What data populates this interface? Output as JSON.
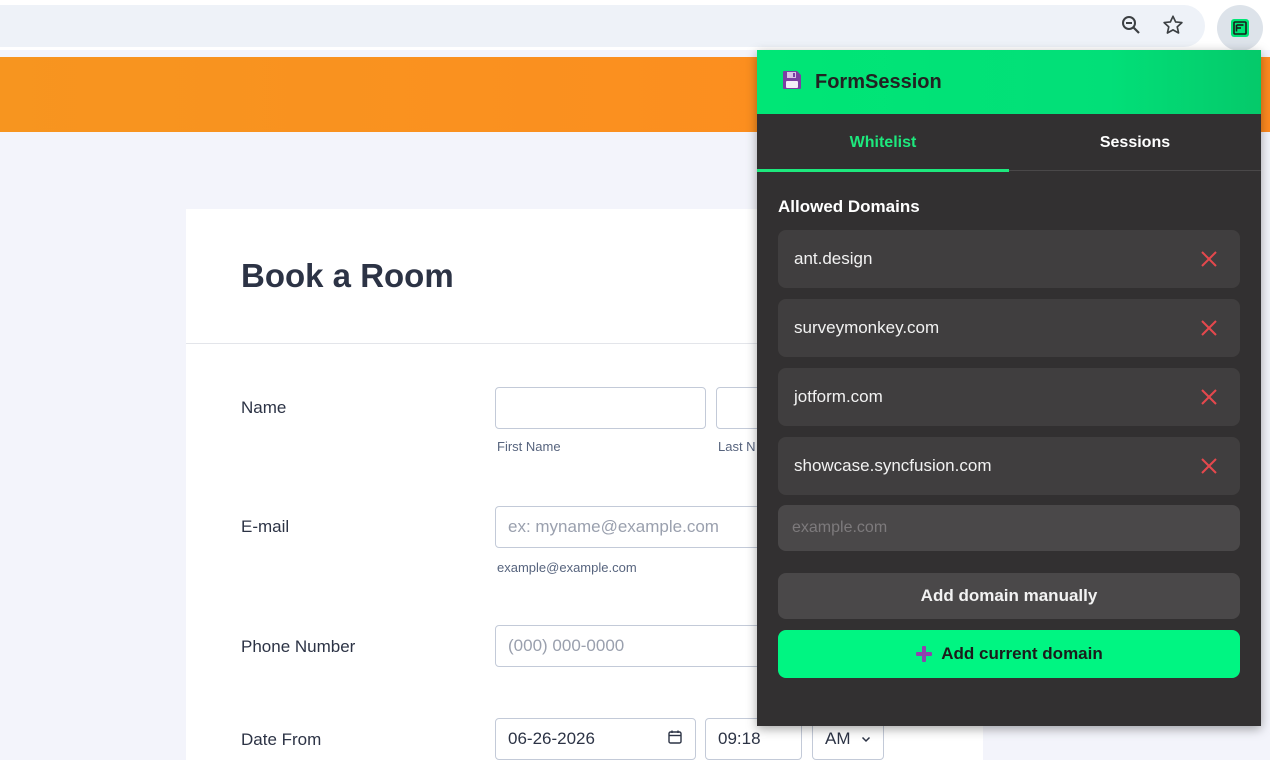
{
  "browser": {
    "zoom_icon": "zoom-out-icon",
    "bookmark_icon": "star-icon",
    "extension_icon": "formsession-extension-icon"
  },
  "form": {
    "title": "Book a Room",
    "fields": {
      "name": {
        "label": "Name",
        "first_sub": "First Name",
        "last_sub": "Last N"
      },
      "email": {
        "label": "E-mail",
        "placeholder": "ex: myname@example.com",
        "sub": "example@example.com"
      },
      "phone": {
        "label": "Phone Number",
        "placeholder": "(000) 000-0000"
      },
      "date_from": {
        "label": "Date From",
        "date": "06-26-2026",
        "time": "09:18",
        "ampm": "AM"
      }
    }
  },
  "popup": {
    "title": "FormSession",
    "tabs": [
      {
        "label": "Whitelist",
        "active": true
      },
      {
        "label": "Sessions",
        "active": false
      }
    ],
    "section_title": "Allowed Domains",
    "domains": [
      "ant.design",
      "surveymonkey.com",
      "jotform.com",
      "showcase.syncfusion.com"
    ],
    "input_placeholder": "example.com",
    "add_manual_label": "Add domain manually",
    "add_current_label": "Add current domain",
    "colors": {
      "accent": "#00f582",
      "remove": "#e5484d",
      "panel": "#323031"
    }
  }
}
